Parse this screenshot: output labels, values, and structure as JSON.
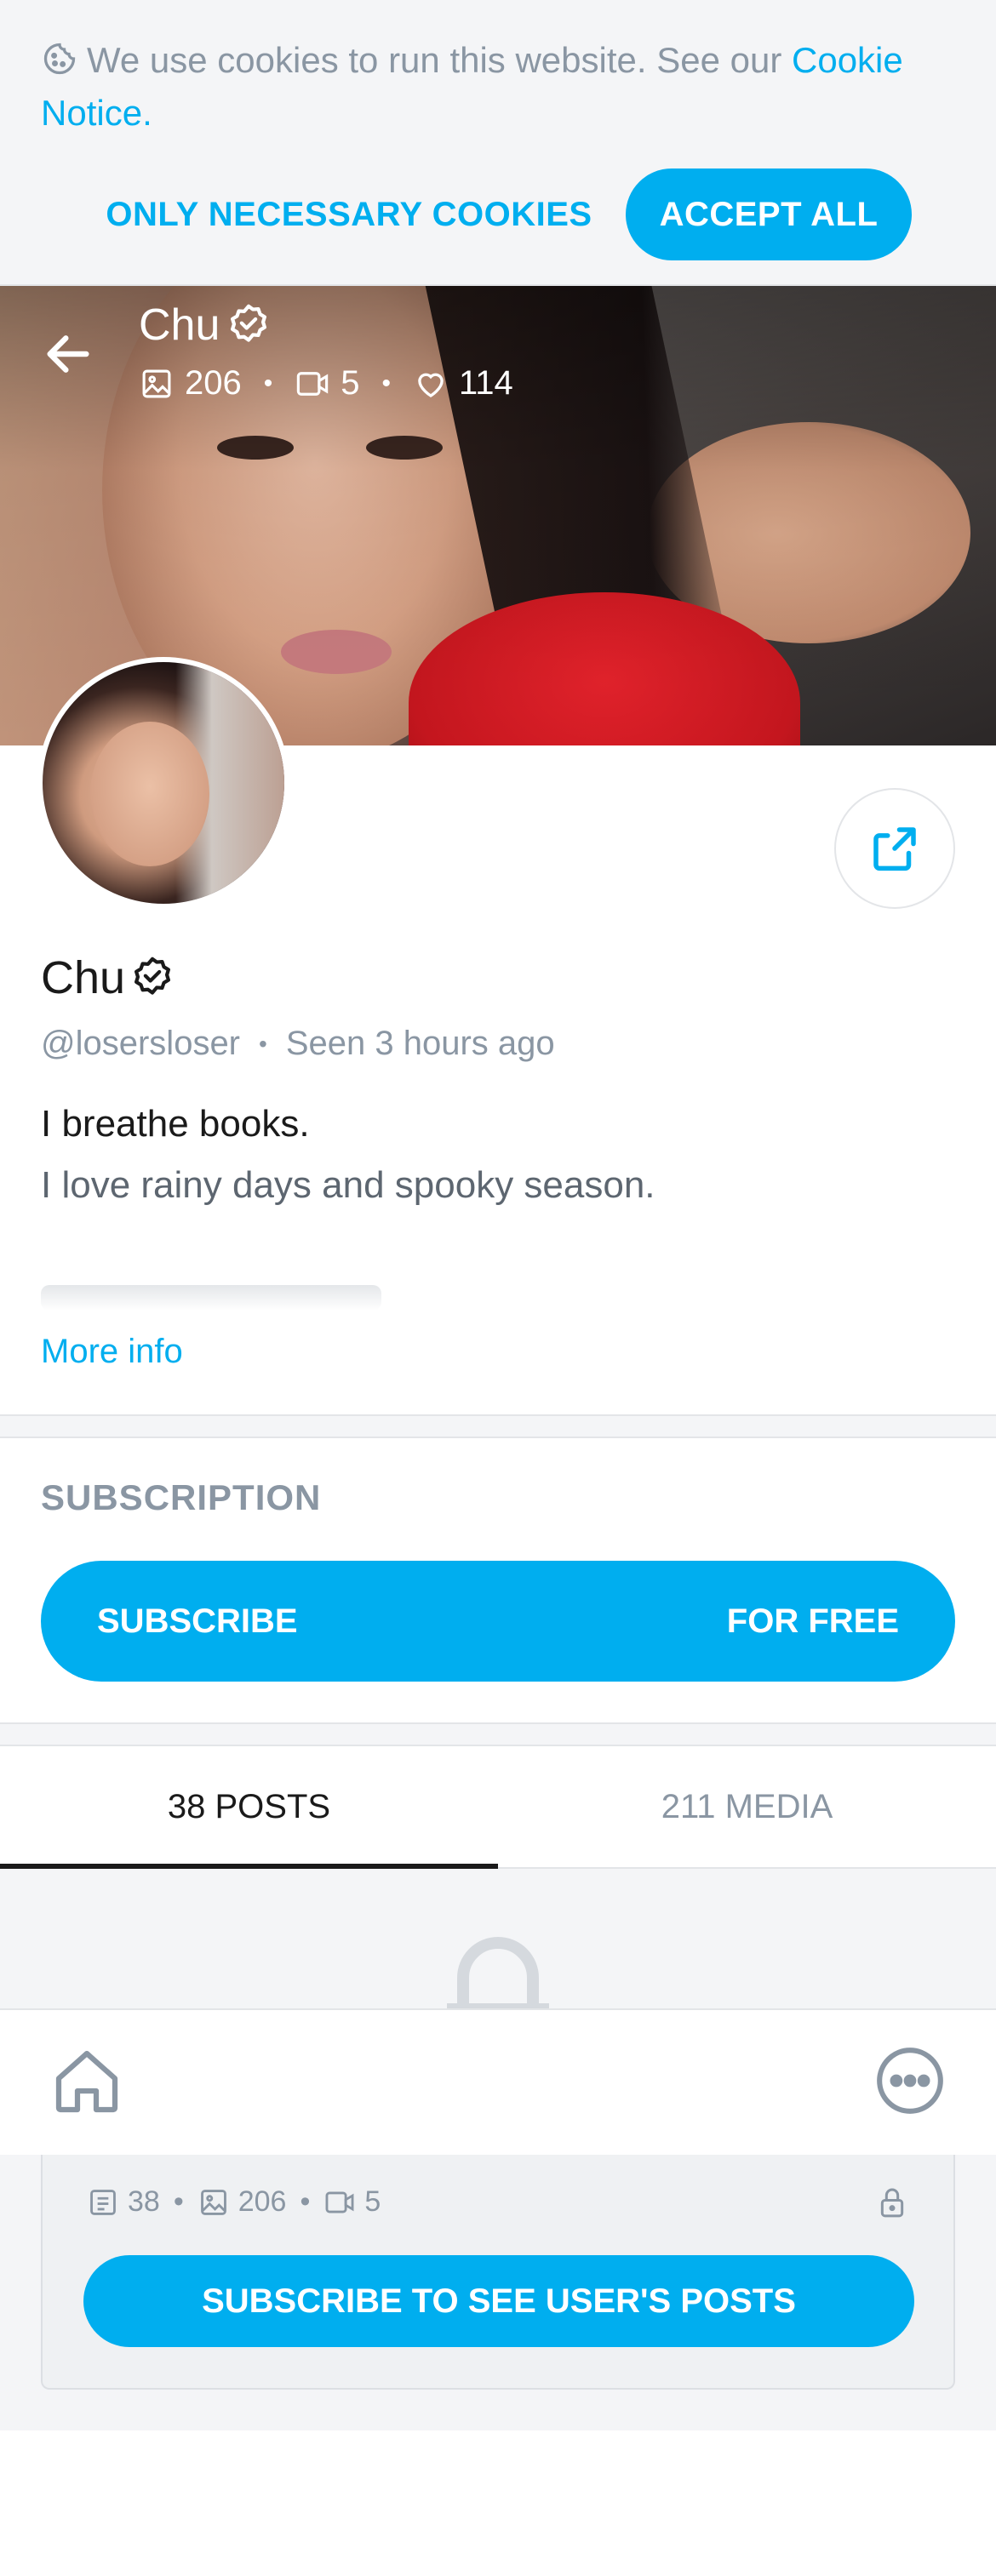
{
  "cookie_banner": {
    "text": "We use cookies to run this website. See our",
    "link": "Cookie Notice",
    "link_suffix": ".",
    "necessary_button": "ONLY NECESSARY COOKIES",
    "accept_button": "ACCEPT ALL"
  },
  "header": {
    "name": "Chu",
    "photos": "206",
    "videos": "5",
    "likes": "114"
  },
  "profile": {
    "name": "Chu",
    "handle": "@losersloser",
    "seen_label": "Seen",
    "seen_time": "3 hours ago",
    "bio_line1": "I breathe books.",
    "bio_line2": "I love rainy days and spooky season.",
    "more_info": "More info"
  },
  "subscription": {
    "title": "SUBSCRIPTION",
    "button_left": "SUBSCRIBE",
    "button_right": "FOR FREE"
  },
  "tabs": [
    {
      "label": "38 POSTS",
      "active": true
    },
    {
      "label": "211 MEDIA",
      "active": false
    }
  ],
  "locked_card": {
    "posts": "38",
    "photos": "206",
    "videos": "5",
    "button": "SUBSCRIBE TO SEE USER'S POSTS"
  },
  "colors": {
    "accent": "#00aeef",
    "muted": "#8a96a3",
    "background_gray": "#f4f5f7"
  },
  "icons": [
    "cookie-icon",
    "back-arrow-icon",
    "verified-icon",
    "image-icon",
    "video-icon",
    "heart-icon",
    "share-icon",
    "lock-icon",
    "home-icon",
    "more-icon",
    "post-icon"
  ]
}
